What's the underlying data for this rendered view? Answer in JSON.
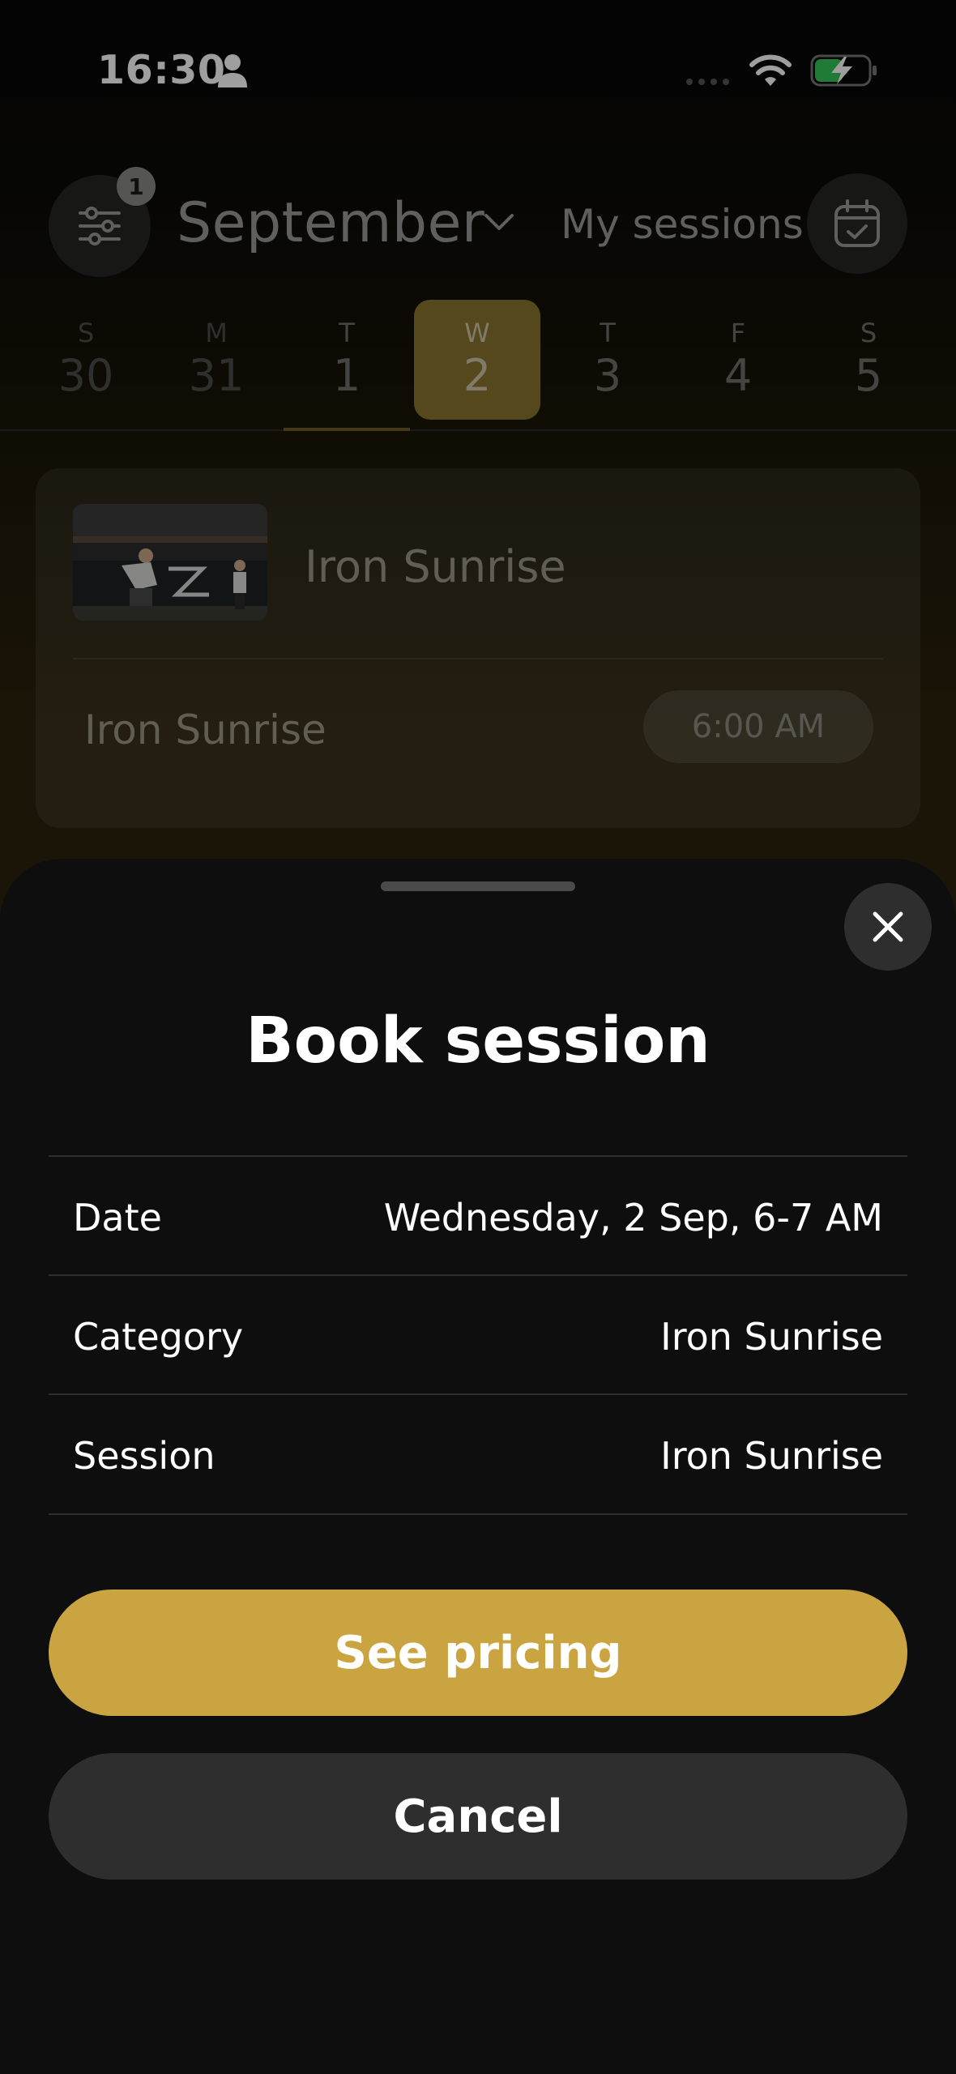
{
  "status_bar": {
    "time": "16:30"
  },
  "header": {
    "filter_badge": "1",
    "month": "September",
    "my_sessions_label": "My sessions"
  },
  "days": [
    {
      "dow": "S",
      "num": "30"
    },
    {
      "dow": "M",
      "num": "31"
    },
    {
      "dow": "T",
      "num": "1"
    },
    {
      "dow": "W",
      "num": "2"
    },
    {
      "dow": "T",
      "num": "3"
    },
    {
      "dow": "F",
      "num": "4"
    },
    {
      "dow": "S",
      "num": "5"
    }
  ],
  "card": {
    "category": "Iron Sunrise",
    "session": "Iron Sunrise",
    "time": "6:00 AM"
  },
  "sheet": {
    "title": "Book session",
    "rows": [
      {
        "label": "Date",
        "value": "Wednesday, 2 Sep, 6-7 AM"
      },
      {
        "label": "Category",
        "value": "Iron Sunrise"
      },
      {
        "label": "Session",
        "value": "Iron Sunrise"
      }
    ],
    "primary_button": "See pricing",
    "secondary_button": "Cancel"
  },
  "colors": {
    "accent": "#c9a440",
    "sheet_bg": "#0e0e0e",
    "secondary_button": "#2e2e2e"
  }
}
